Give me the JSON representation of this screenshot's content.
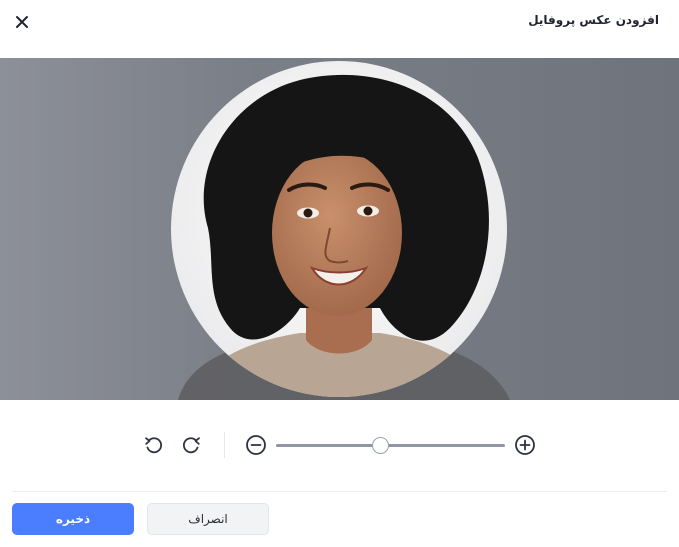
{
  "dialog": {
    "title": "افزودن عکس پروفایل",
    "close_icon": "close-icon"
  },
  "image": {
    "subject": "profile-photo"
  },
  "controls": {
    "rotate_left_icon": "rotate-left-icon",
    "rotate_right_icon": "rotate-right-icon",
    "zoom_out_icon": "zoom-out-icon",
    "zoom_in_icon": "zoom-in-icon",
    "zoom_level": 0.46
  },
  "footer": {
    "save_label": "ذخیره",
    "cancel_label": "انصراف"
  },
  "colors": {
    "primary": "#4a7dff",
    "secondary_bg": "#f2f3f5",
    "overlay": "#7b7f88"
  }
}
